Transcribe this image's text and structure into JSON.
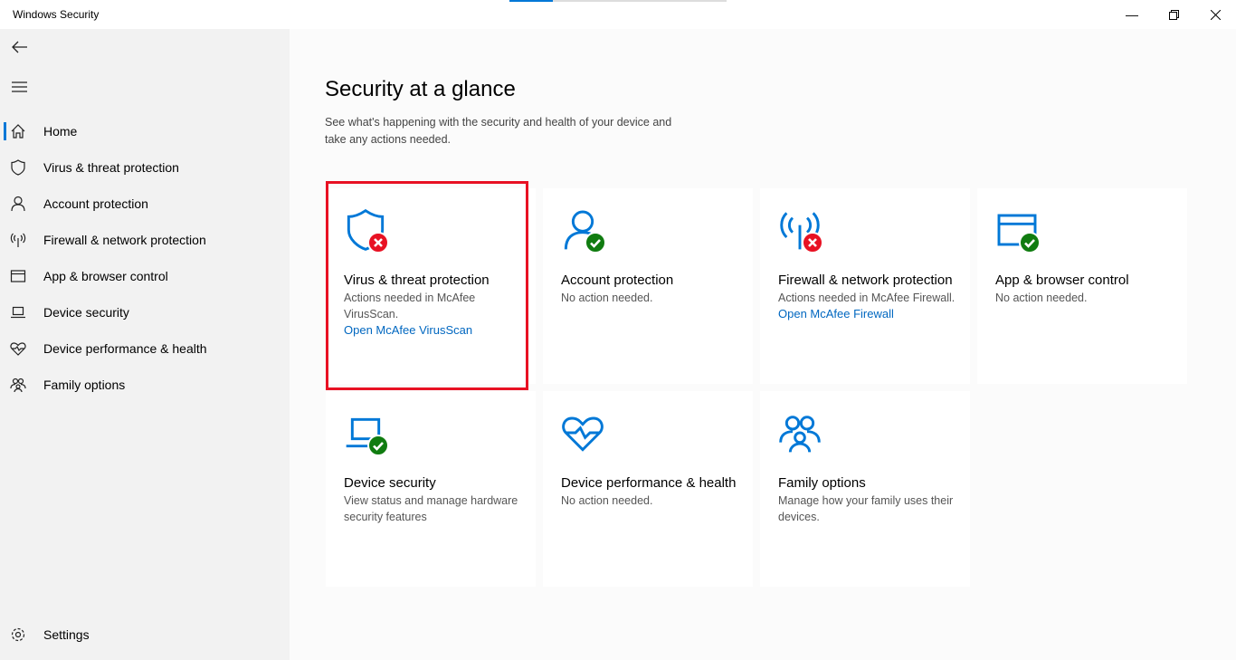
{
  "window": {
    "title": "Windows Security",
    "controls": [
      "minimize",
      "maximize",
      "close"
    ]
  },
  "sidebar": {
    "items": [
      {
        "label": "Home",
        "icon": "home-icon",
        "active": true
      },
      {
        "label": "Virus & threat protection",
        "icon": "shield-icon"
      },
      {
        "label": "Account protection",
        "icon": "person-icon"
      },
      {
        "label": "Firewall & network protection",
        "icon": "antenna-icon"
      },
      {
        "label": "App & browser control",
        "icon": "browser-window-icon"
      },
      {
        "label": "Device security",
        "icon": "laptop-icon"
      },
      {
        "label": "Device performance & health",
        "icon": "heart-icon"
      },
      {
        "label": "Family options",
        "icon": "family-icon"
      }
    ],
    "settings": "Settings"
  },
  "main": {
    "title": "Security at a glance",
    "subtitle": "See what's happening with the security and health of your device and take any actions needed.",
    "cards": [
      {
        "title": "Virus & threat protection",
        "desc": "Actions needed in McAfee VirusScan.",
        "link": "Open McAfee VirusScan",
        "status": "error",
        "icon": "shield-icon"
      },
      {
        "title": "Account protection",
        "desc": "No action needed.",
        "status": "ok",
        "icon": "person-icon"
      },
      {
        "title": "Firewall & network protection",
        "desc": "Actions needed in McAfee Firewall.",
        "link": "Open McAfee Firewall",
        "status": "error",
        "icon": "antenna-icon"
      },
      {
        "title": "App & browser control",
        "desc": "No action needed.",
        "status": "ok",
        "icon": "browser-window-icon"
      },
      {
        "title": "Device security",
        "desc": "View status and manage hardware security features",
        "status": "ok",
        "icon": "laptop-icon"
      },
      {
        "title": "Device performance & health",
        "desc": "No action needed.",
        "icon": "heart-icon"
      },
      {
        "title": "Family options",
        "desc": "Manage how your family uses their devices.",
        "icon": "family-icon"
      }
    ]
  },
  "colors": {
    "accent": "#0078d7",
    "error": "#e81123",
    "ok": "#107c10",
    "highlight": "#e81123"
  }
}
